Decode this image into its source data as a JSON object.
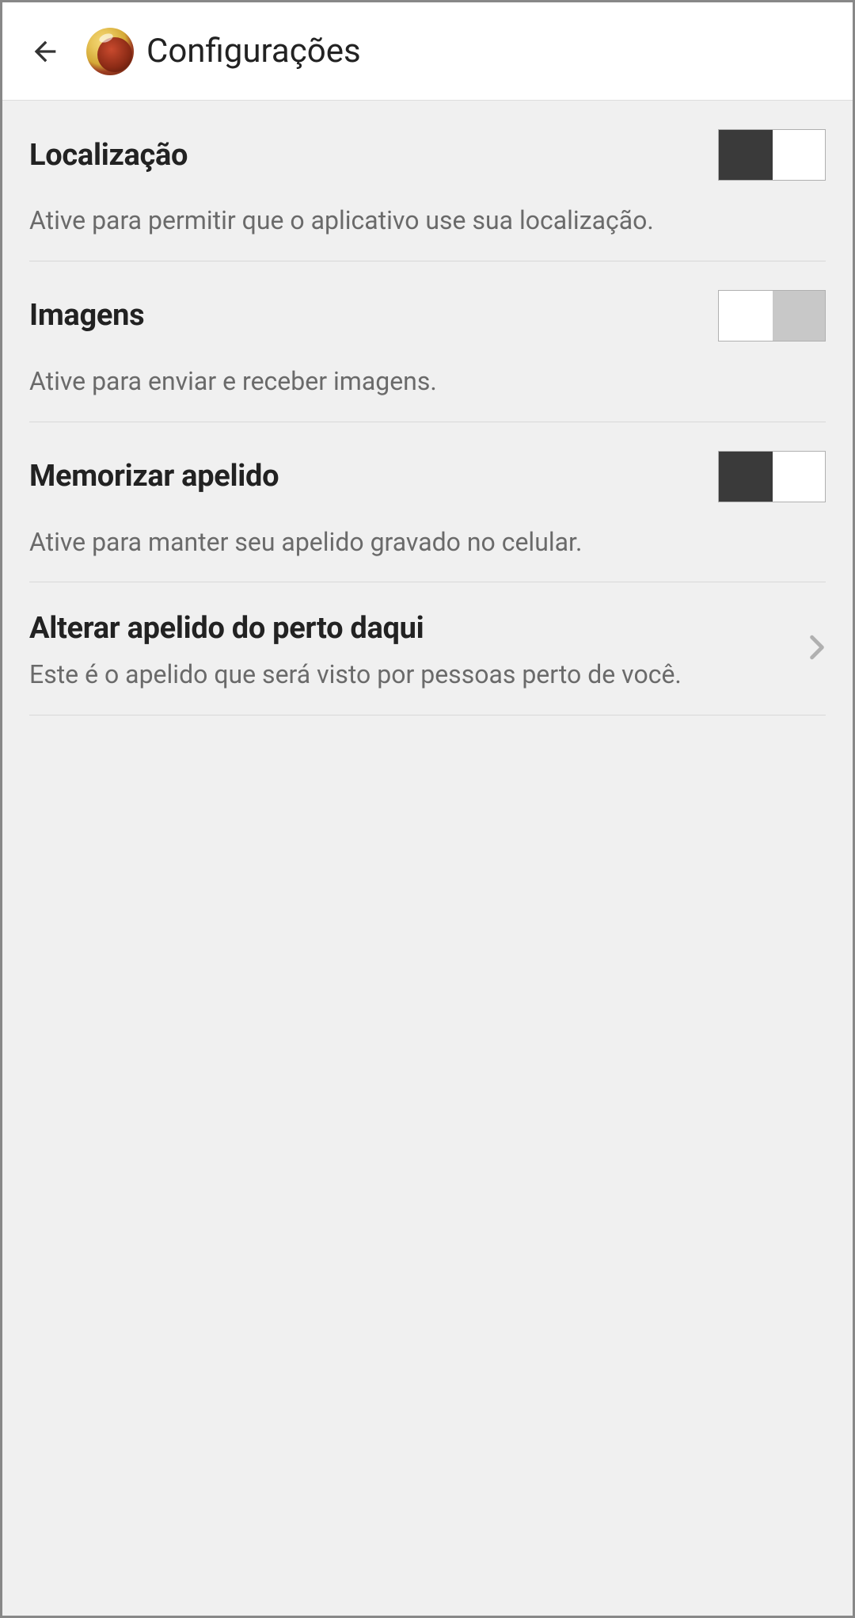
{
  "header": {
    "title": "Configurações"
  },
  "settings": {
    "localization": {
      "title": "Localização",
      "description": "Ative para permitir que o aplicativo use sua localização.",
      "enabled": true
    },
    "images": {
      "title": "Imagens",
      "description": "Ative para enviar e receber imagens.",
      "enabled": false
    },
    "remember_nickname": {
      "title": "Memorizar apelido",
      "description": "Ative para manter seu apelido gravado no celular.",
      "enabled": true
    },
    "change_nickname": {
      "title": "Alterar apelido do perto daqui",
      "description": "Este é o apelido que será visto por pessoas perto de você."
    }
  }
}
